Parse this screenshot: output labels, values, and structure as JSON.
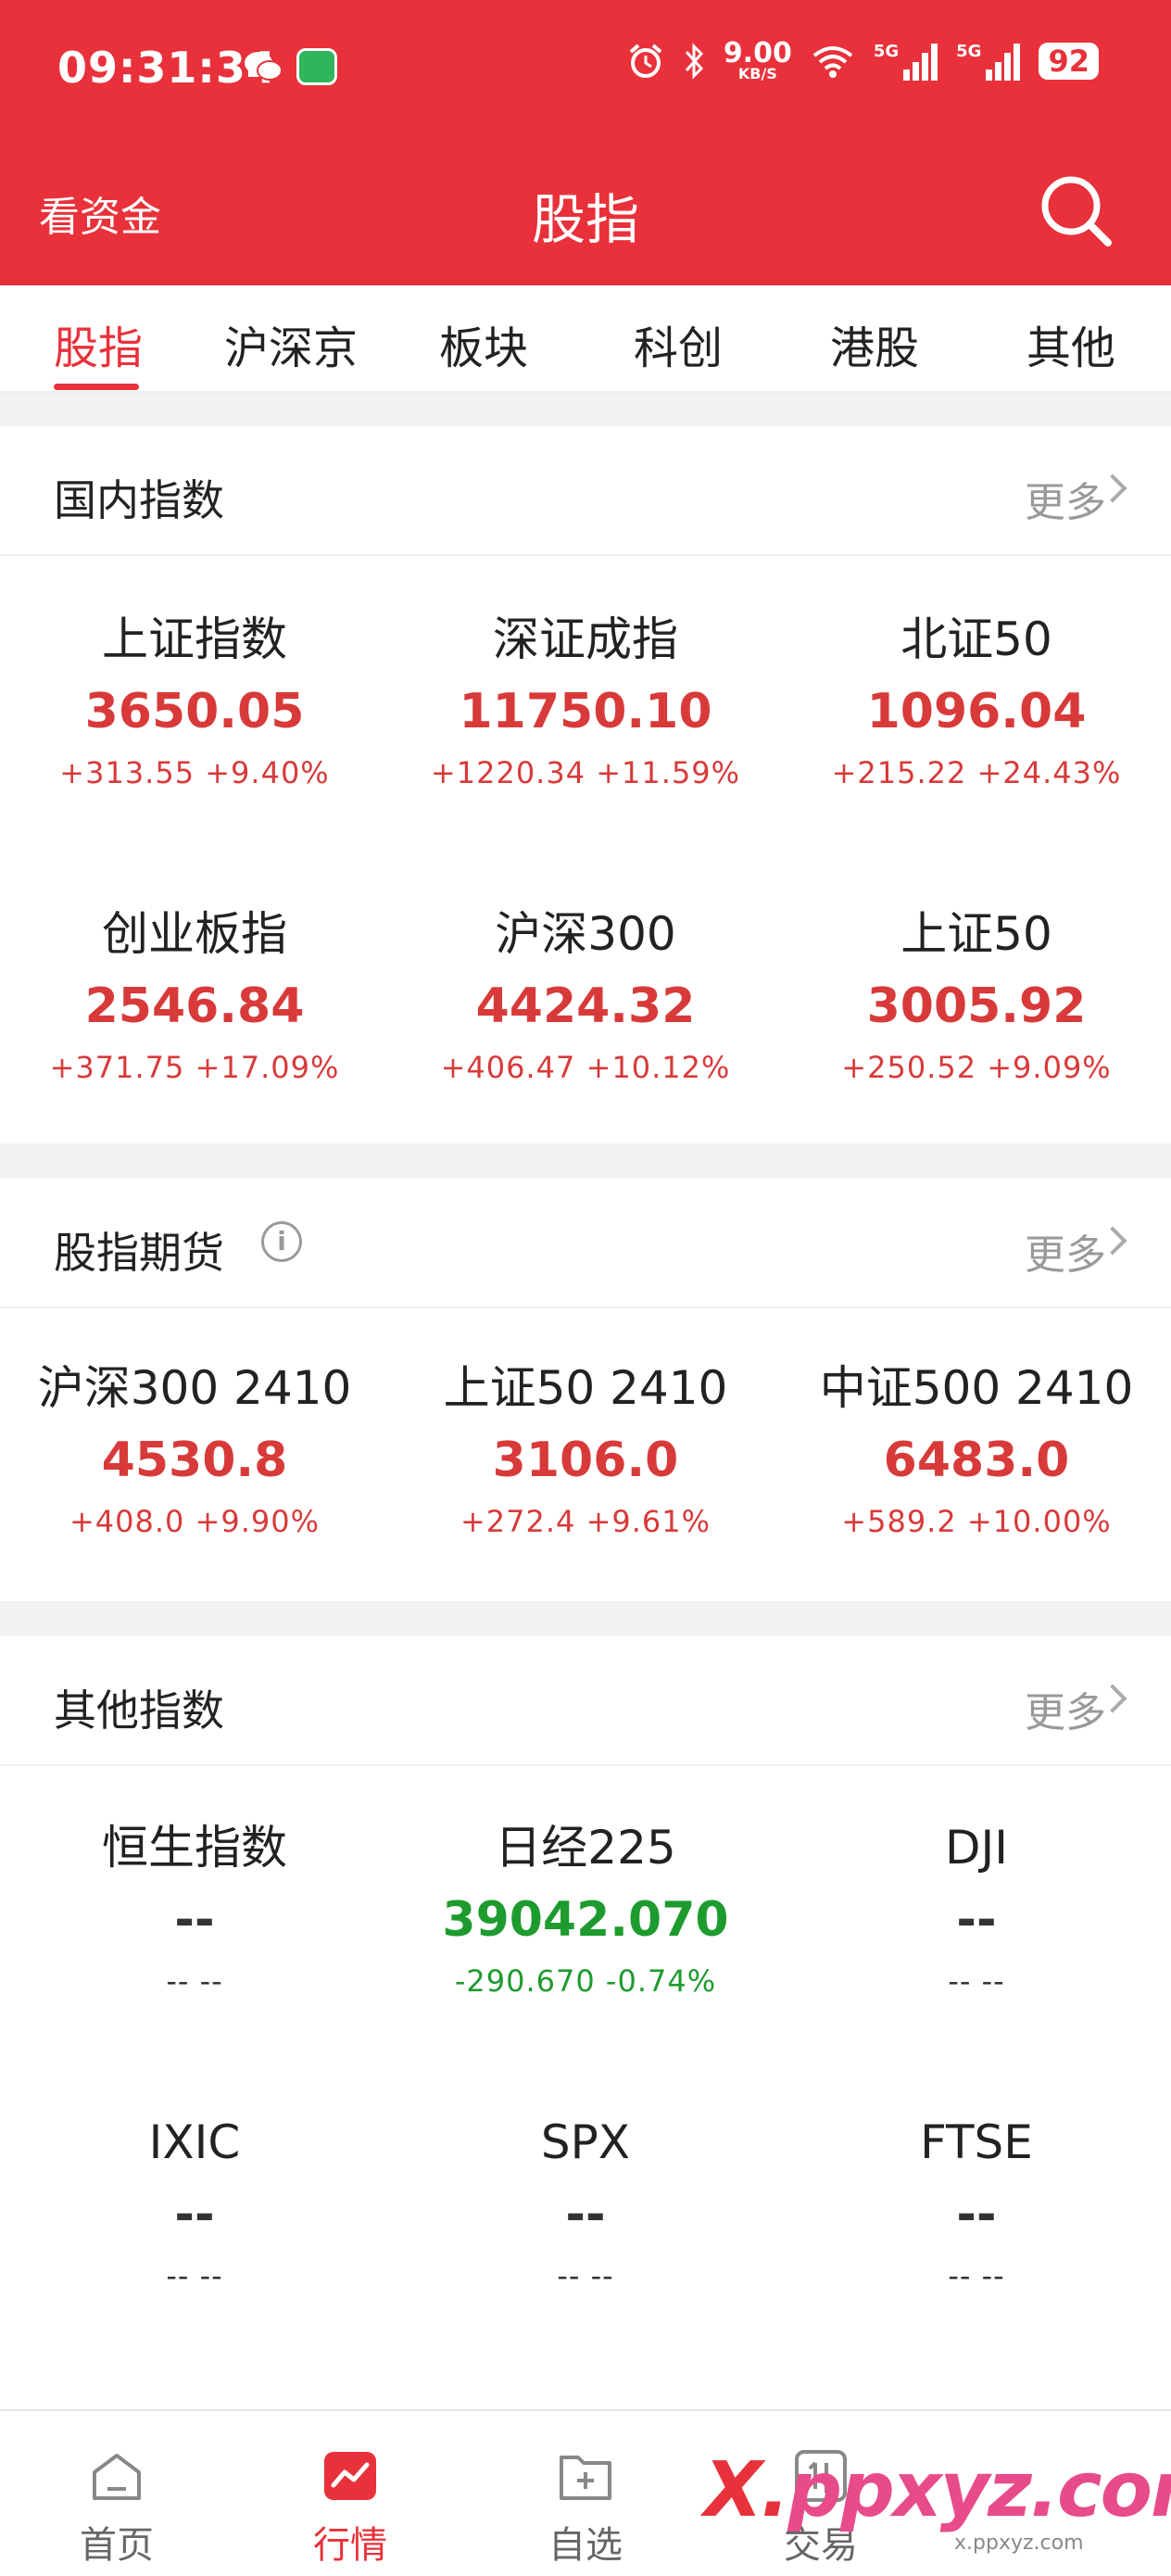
{
  "status": {
    "time": "09:31:34",
    "speed_value": "9.00",
    "speed_unit": "KB/S",
    "signal_label": "5G",
    "battery": "92"
  },
  "header": {
    "left_label": "看资金",
    "title": "股指"
  },
  "tabs": [
    "股指",
    "沪深京",
    "板块",
    "科创",
    "港股",
    "其他"
  ],
  "domestic": {
    "title": "国内指数",
    "more": "更多",
    "items": [
      {
        "name": "上证指数",
        "value": "3650.05",
        "change": "+313.55  +9.40%"
      },
      {
        "name": "深证成指",
        "value": "11750.10",
        "change": "+1220.34  +11.59%"
      },
      {
        "name": "北证50",
        "value": "1096.04",
        "change": "+215.22  +24.43%"
      },
      {
        "name": "创业板指",
        "value": "2546.84",
        "change": "+371.75  +17.09%"
      },
      {
        "name": "沪深300",
        "value": "4424.32",
        "change": "+406.47  +10.12%"
      },
      {
        "name": "上证50",
        "value": "3005.92",
        "change": "+250.52  +9.09%"
      }
    ]
  },
  "futures": {
    "title": "股指期货",
    "info_icon": "i",
    "more": "更多",
    "items": [
      {
        "name": "沪深300 2410",
        "value": "4530.8",
        "change": "+408.0  +9.90%"
      },
      {
        "name": "上证50 2410",
        "value": "3106.0",
        "change": "+272.4  +9.61%"
      },
      {
        "name": "中证500 2410",
        "value": "6483.0",
        "change": "+589.2  +10.00%"
      }
    ]
  },
  "other": {
    "title": "其他指数",
    "more": "更多",
    "items": [
      {
        "name": "恒生指数",
        "value": "--",
        "change": "-- --"
      },
      {
        "name": "日经225",
        "value": "39042.070",
        "change": "-290.670  -0.74%"
      },
      {
        "name": "DJI",
        "value": "--",
        "change": "-- --"
      },
      {
        "name": "IXIC",
        "value": "--",
        "change": "-- --"
      },
      {
        "name": "SPX",
        "value": "--",
        "change": "-- --"
      },
      {
        "name": "FTSE",
        "value": "--",
        "change": "-- --"
      }
    ]
  },
  "bottom_nav": [
    {
      "label": "首页",
      "icon": "home-icon"
    },
    {
      "label": "行情",
      "icon": "market-icon"
    },
    {
      "label": "自选",
      "icon": "watchlist-icon"
    },
    {
      "label": "交易",
      "icon": "trade-icon"
    }
  ],
  "watermark": {
    "text_x": "X.",
    "text_rest": "ppxyz.com",
    "sub": "x.ppxyz.com"
  },
  "colors": {
    "brand_red": "#e8313a",
    "up": "#d83a3a",
    "down": "#1e9b2e"
  }
}
